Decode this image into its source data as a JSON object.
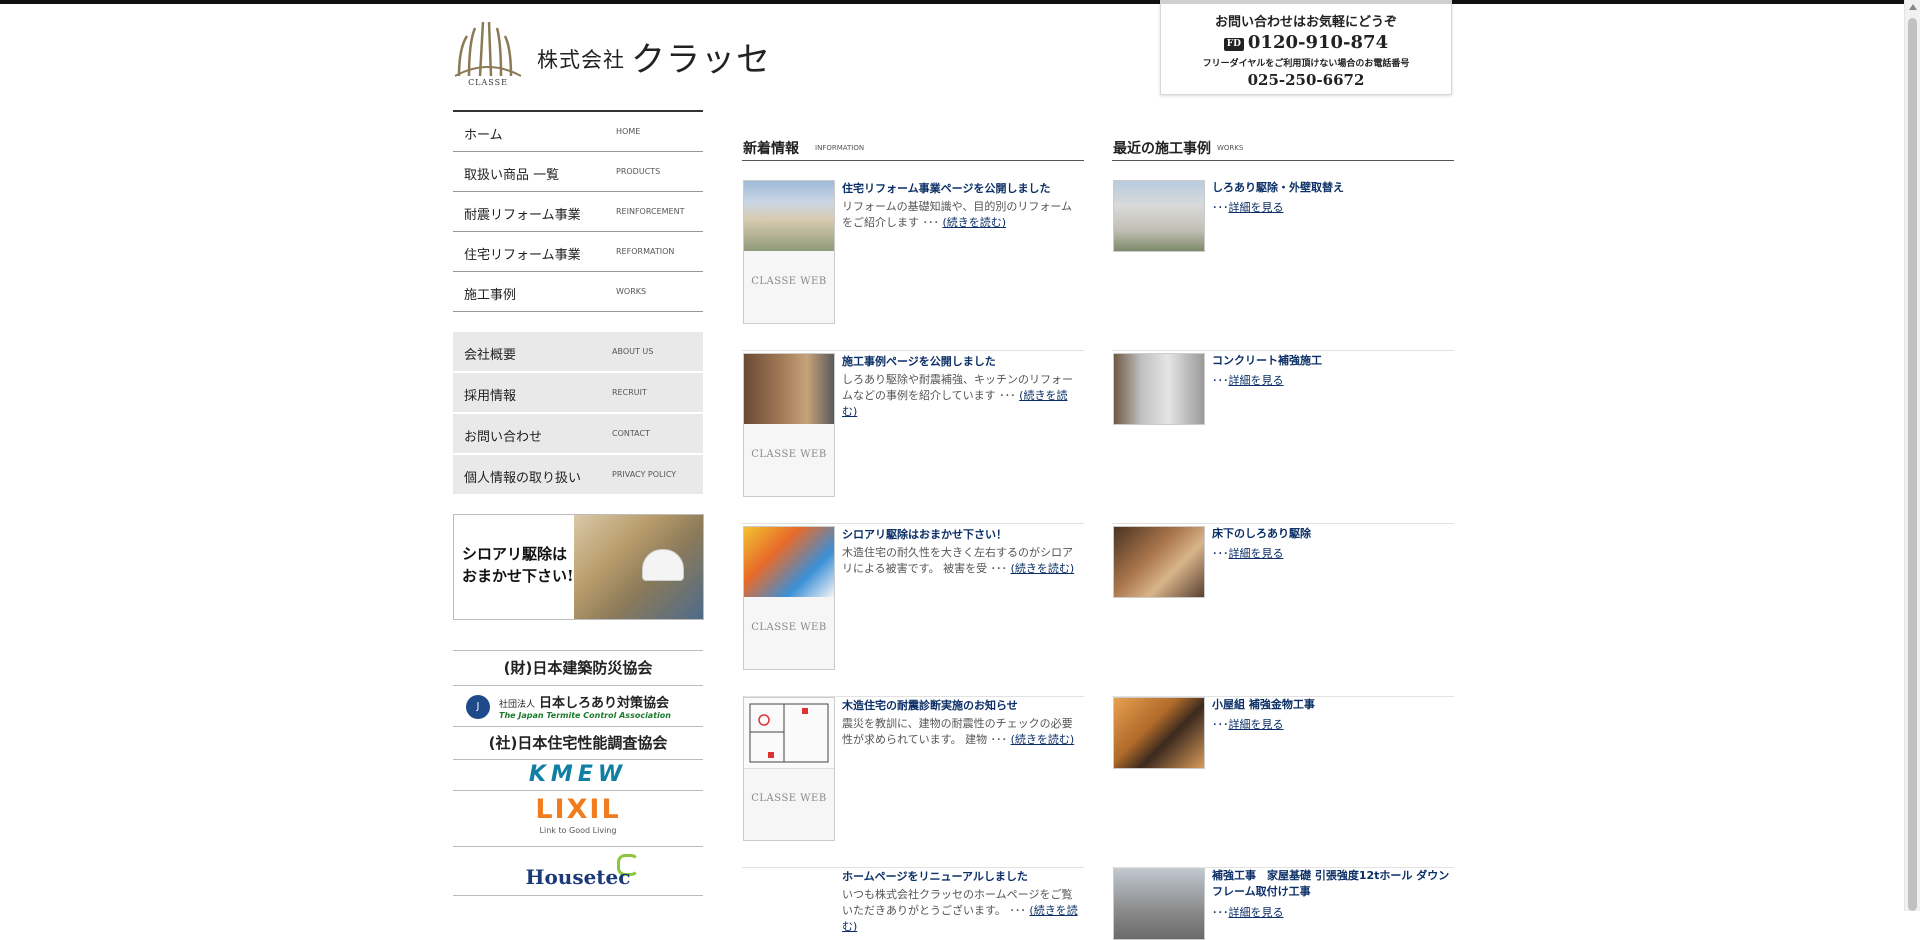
{
  "colors": {
    "link": "#0b2f66",
    "nav_bg": "#e9e9e9"
  },
  "header": {
    "logo_sub": "CLASSE",
    "company_prefix": "株式会社",
    "company_name": "クラッセ",
    "contact": {
      "intro": "お問い合わせはお気軽にどうぞ",
      "freedial_label": "FD",
      "freedial": "0120-910-874",
      "note": "フリーダイヤルをご利用頂けない場合のお電話番号",
      "phone": "025-250-6672"
    }
  },
  "sidebar": {
    "nav": [
      {
        "jp": "ホーム",
        "en": "HOME"
      },
      {
        "jp": "取扱い商品 一覧",
        "en": "PRODUCTS"
      },
      {
        "jp": "耐震リフォーム事業",
        "en": "REINFORCEMENT"
      },
      {
        "jp": "住宅リフォーム事業",
        "en": "REFORMATION"
      },
      {
        "jp": "施工事例",
        "en": "WORKS"
      }
    ],
    "nav2": [
      {
        "jp": "会社概要",
        "en": "ABOUT US"
      },
      {
        "jp": "採用情報",
        "en": "RECRUIT"
      },
      {
        "jp": "お問い合わせ",
        "en": "CONTACT"
      },
      {
        "jp": "個人情報の取り扱い",
        "en": "PRIVACY POLICY"
      }
    ],
    "banner": {
      "line1": "シロアリ駆除は",
      "line2": "おまかせ下さい!"
    },
    "partners": {
      "p1": "(財)日本建築防災協会",
      "p2_prefix": "社団法人",
      "p2_name": "日本しろあり対策協会",
      "p2_en": "The Japan Termite Control Association",
      "p3": "(社)日本住宅性能調査協会",
      "p4": "KMEW",
      "p5": "LIXIL",
      "p5_tag": "Link to Good Living",
      "p6": "Housetec"
    }
  },
  "news": {
    "title_jp": "新着情報",
    "title_en": "INFORMATION",
    "thumb_label": "CLASSE WEB",
    "more_label": "(続きを読む)",
    "items": [
      {
        "title": "住宅リフォーム事業ページを公開しました",
        "body": "リフォームの基礎知識や、目的別のリフォームをご紹介します ･･･"
      },
      {
        "title": "施工事例ページを公開しました",
        "body": "しろあり駆除や耐震補強、キッチンのリフォームなどの事例を紹介しています ･･･"
      },
      {
        "title": "シロアリ駆除はおまかせ下さい！",
        "body": "木造住宅の耐久性を大きく左右するのがシロアリによる被害です。 被害を受 ･･･"
      },
      {
        "title": "木造住宅の耐震診断実施のお知らせ",
        "body": "震災を教訓に、建物の耐震性のチェックの必要性が求められています。 建物 ･･･"
      },
      {
        "title": "ホームページをリニューアルしました",
        "body": "いつも株式会社クラッセのホームページをご覧いただきありがとうございます。 ･･･"
      }
    ]
  },
  "works": {
    "title_jp": "最近の施工事例",
    "title_en": "WORKS",
    "link_prefix": "･･･",
    "link_label": "詳細を見る",
    "items": [
      {
        "title": "しろあり駆除・外壁取替え"
      },
      {
        "title": "コンクリート補強施工"
      },
      {
        "title": "床下のしろあり駆除"
      },
      {
        "title": "小屋組 補強金物工事"
      },
      {
        "title": "補強工事　家屋基礎 引張強度12tホール ダウンフレーム取付け工事"
      }
    ]
  }
}
